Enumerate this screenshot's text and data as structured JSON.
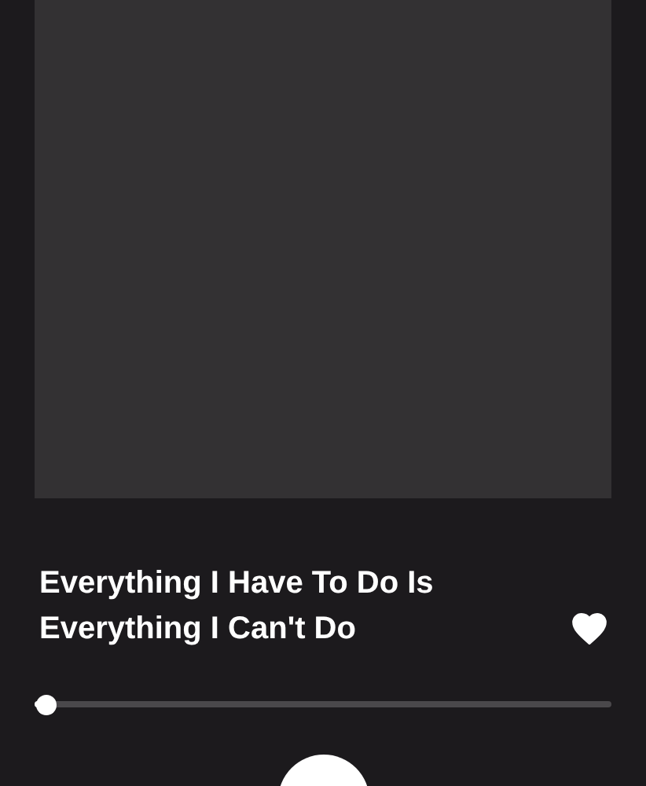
{
  "track": {
    "title": "Everything I Have To Do Is Everything I Can't Do",
    "liked": true
  },
  "progress": {
    "level": 0.02
  }
}
